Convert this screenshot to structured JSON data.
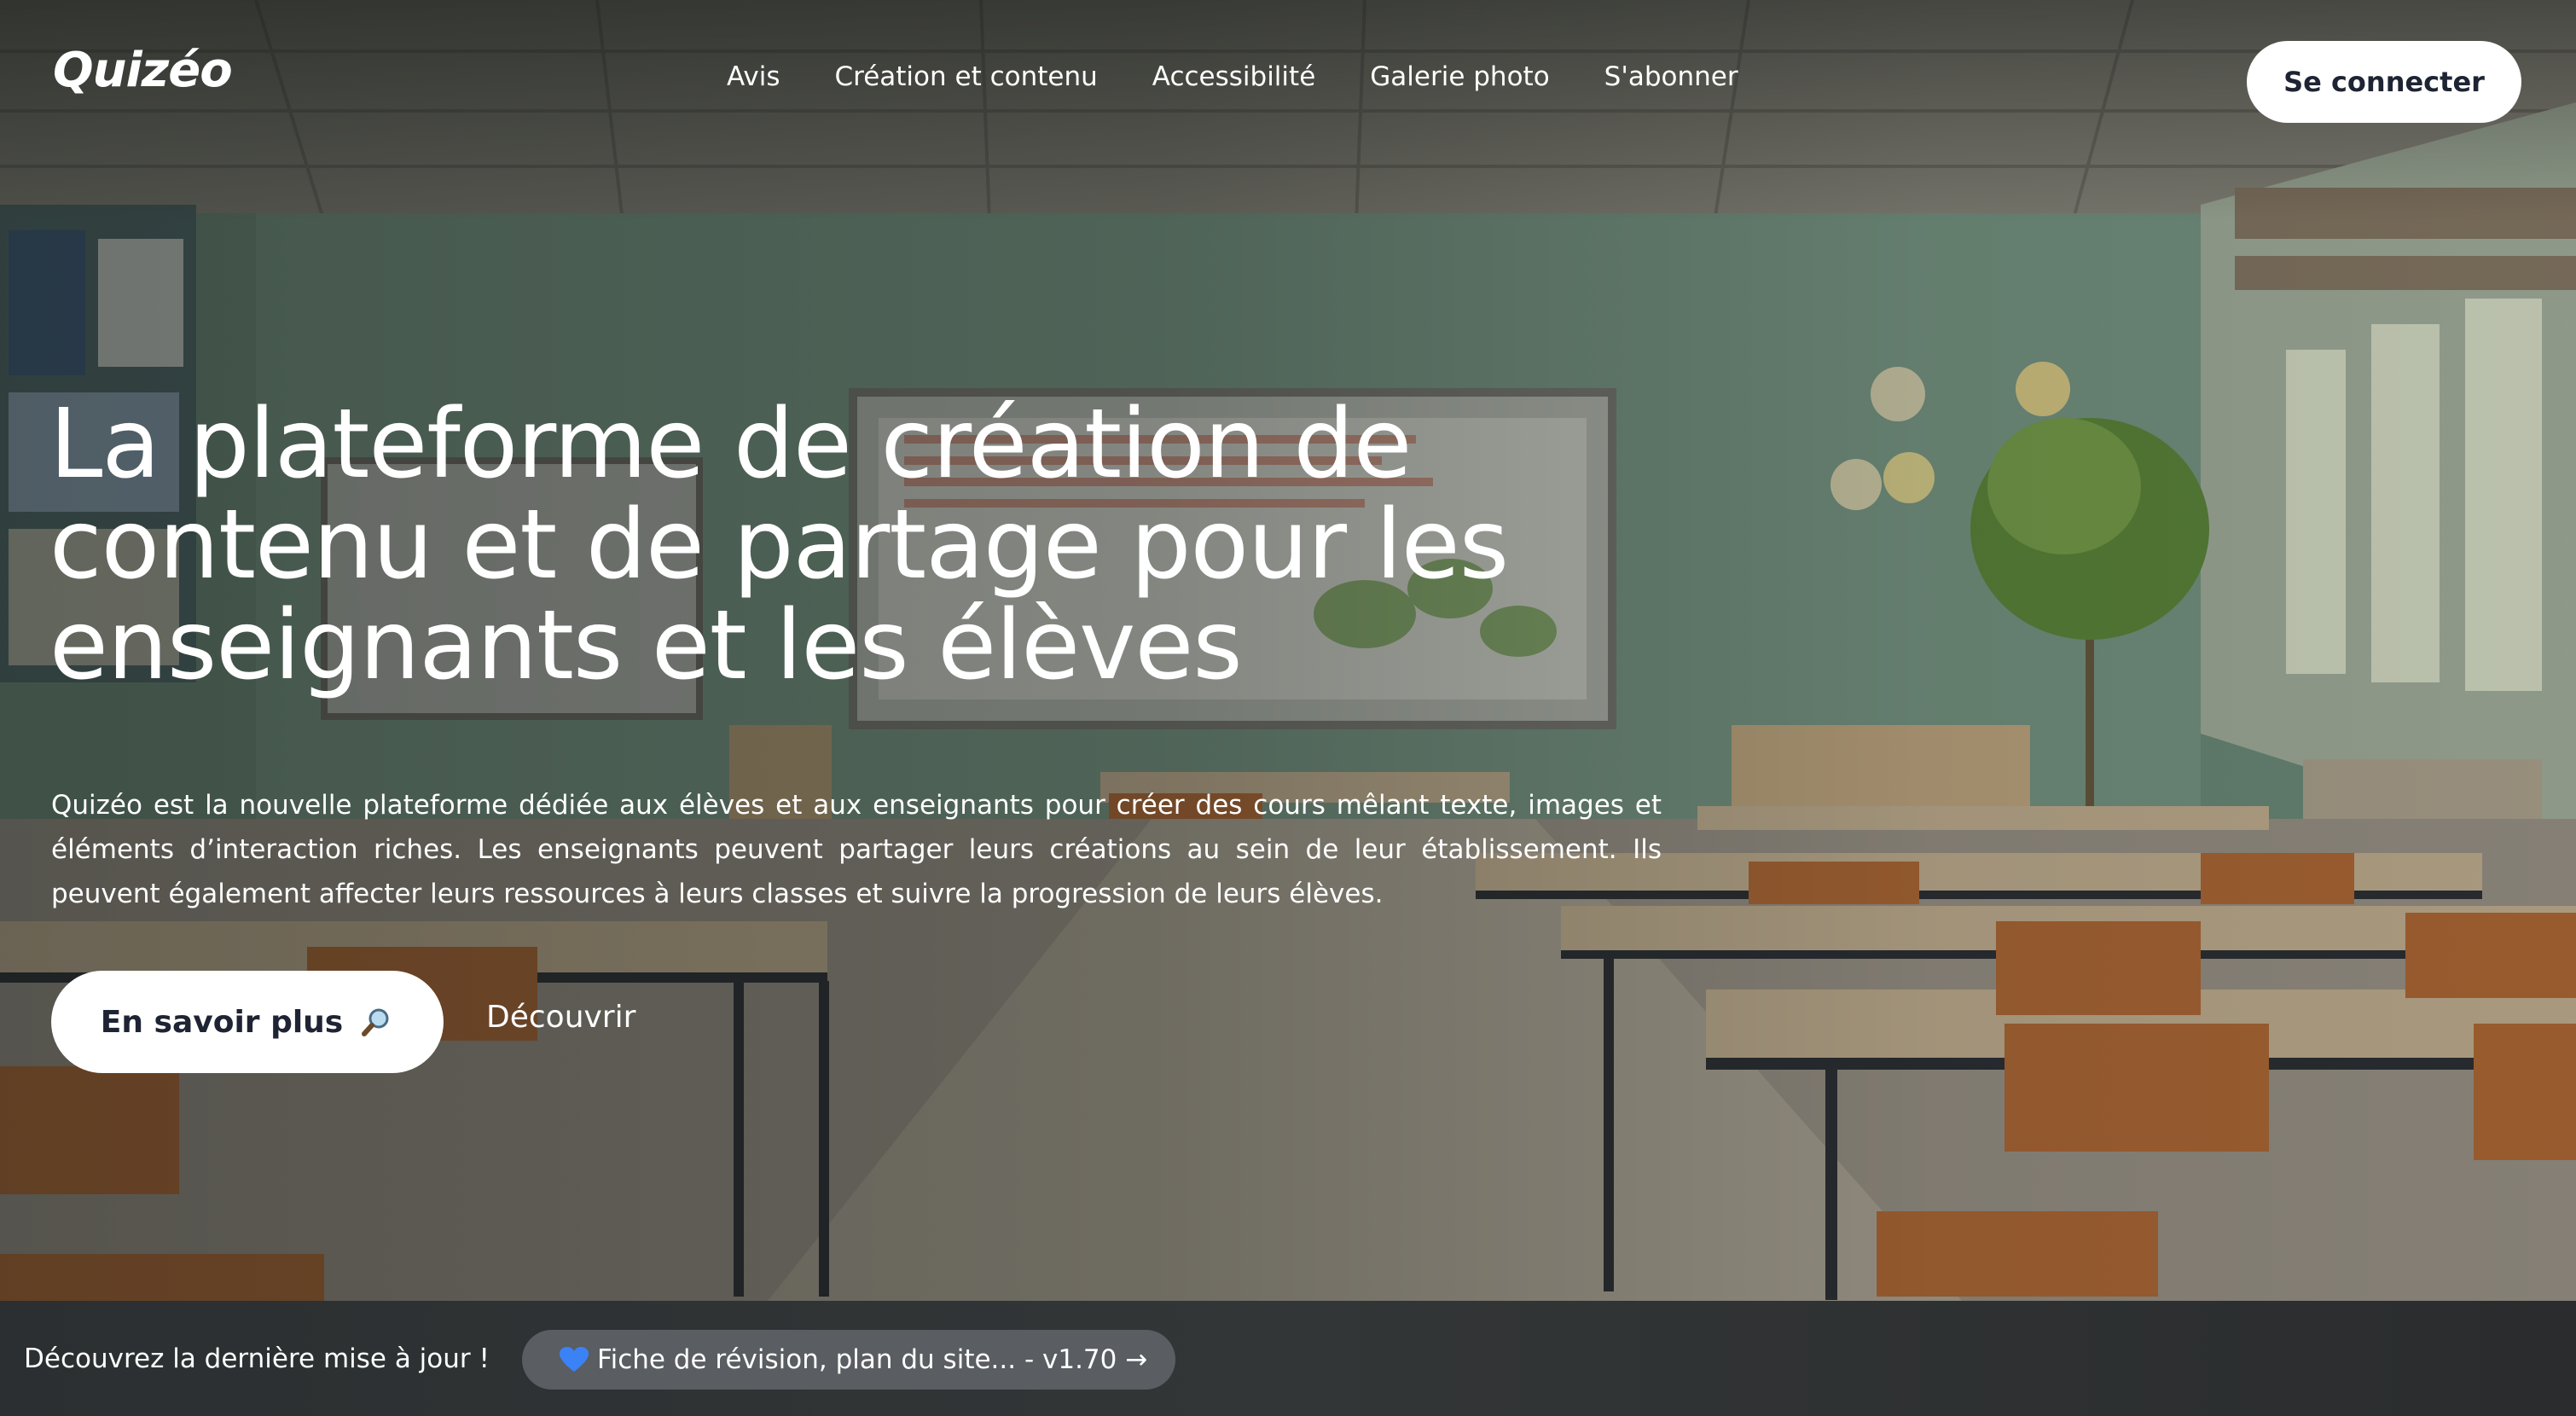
{
  "header": {
    "logo": "Quizéo",
    "nav": [
      "Avis",
      "Création et contenu",
      "Accessibilité",
      "Galerie photo",
      "S'abonner"
    ],
    "login_label": "Se connecter"
  },
  "hero": {
    "title": "La plateforme de création de contenu et de partage pour les enseignants et les élèves",
    "description": "Quizéo est la nouvelle plateforme dédiée aux élèves et aux enseignants pour créer des cours mêlant texte, images et éléments d’interaction riches. Les enseignants peuvent partager leurs créations au sein de leur établissement. Ils peuvent également affecter leurs ressources à leurs classes et suivre la progression de leurs élèves.",
    "primary_cta": "En savoir plus",
    "primary_cta_icon": "magnifying-glass-icon",
    "secondary_cta": "Découvrir"
  },
  "update_banner": {
    "text": "Découvrez la dernière mise à jour !",
    "pill_label": "Fiche de révision, plan du site... - v1.70 →",
    "pill_icon": "blue-heart-icon"
  },
  "colors": {
    "button_bg": "#ffffff",
    "button_text": "#1e2433",
    "banner_bg": "#2f3234",
    "pill_bg": "#5a5d61",
    "heart": "#3b82f6"
  }
}
